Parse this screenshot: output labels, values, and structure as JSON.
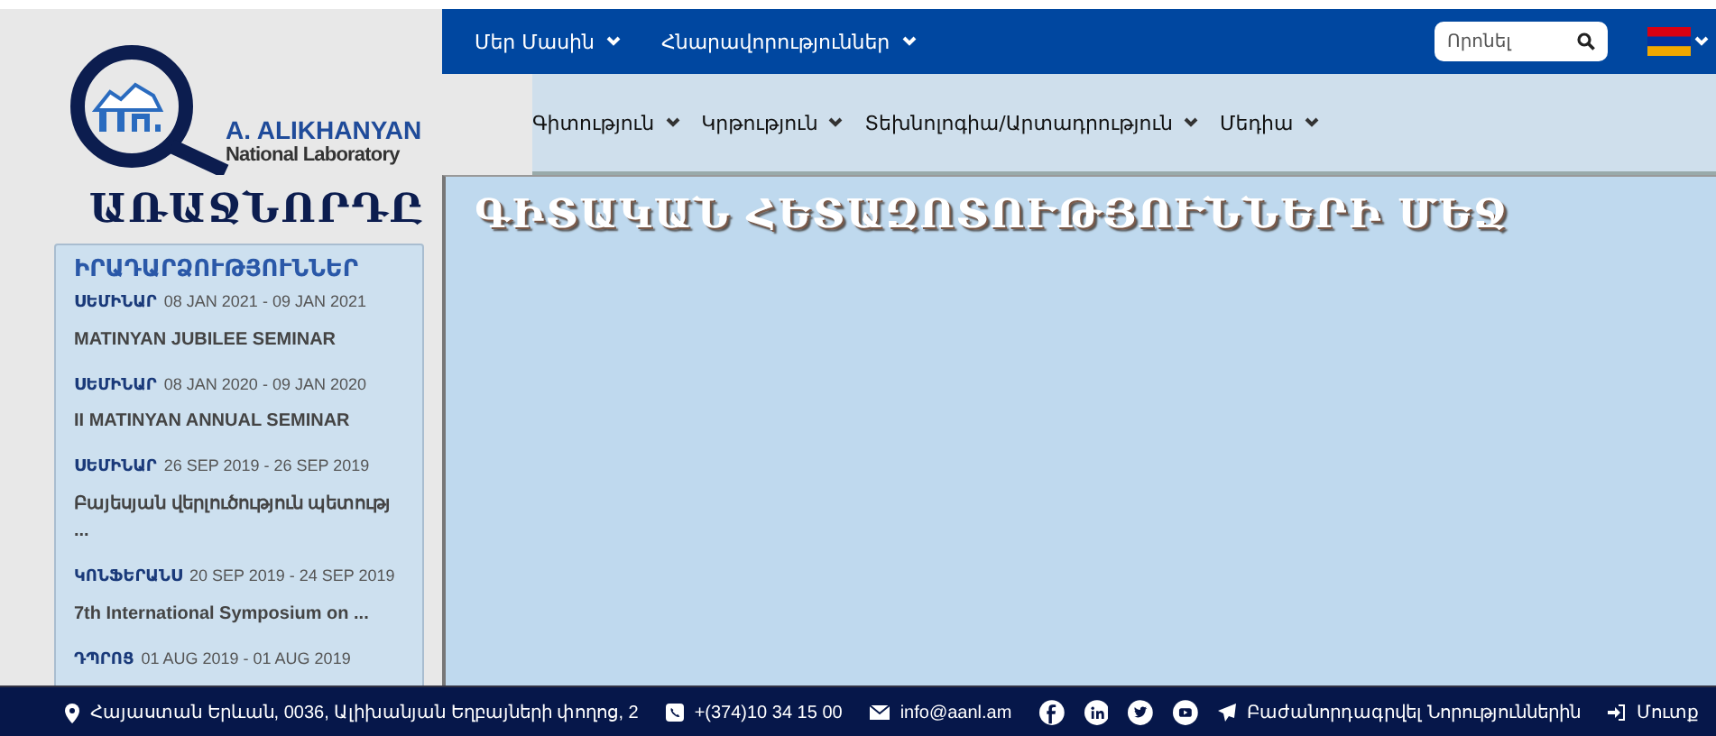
{
  "logo": {
    "line1": "A. ALIKHANYAN",
    "line2": "National Laboratory"
  },
  "top_menu": [
    {
      "label": "Մեր Մասին"
    },
    {
      "label": "Հնարավորություններ"
    }
  ],
  "search": {
    "placeholder": "Որոնել"
  },
  "main_menu": [
    {
      "label": "Գիտություն"
    },
    {
      "label": "Կրթություն"
    },
    {
      "label": "Տեխնոլոգիա/Արտադրություն"
    },
    {
      "label": "Մեդիա"
    }
  ],
  "sidebar": {
    "title": "ԱՌԱՋՆՈՐԴԸ",
    "panel_title": "ԻՐԱԴԱՐՁՈՒԹՅՈՒՆՆԵՐ",
    "events": [
      {
        "category": "ՍԵՄԻՆԱՐ",
        "dates": "08 JAN 2021 - 09 JAN 2021",
        "title": "MATINYAN JUBILEE SEMINAR"
      },
      {
        "category": "ՍԵՄԻՆԱՐ",
        "dates": "08 JAN 2020 - 09 JAN 2020",
        "title": "II MATINYAN ANNUAL SEMINAR"
      },
      {
        "category": "ՍԵՄԻՆԱՐ",
        "dates": "26 SEP 2019 - 26 SEP 2019",
        "title": "Բայեսյան վերլուծություն պետությ ..."
      },
      {
        "category": "ԿՈՆՖԵՐԱՆՍ",
        "dates": "20 SEP 2019 - 24 SEP 2019",
        "title": "7th International Symposium on  ..."
      },
      {
        "category": "ԴՊՐՈՑ",
        "dates": "01 AUG 2019 - 01 AUG 2019"
      }
    ]
  },
  "content": {
    "title": "ԳԻՏԱԿԱՆ ՀԵՏԱԶՈՏՈՒԹՅՈՒՆՆԵՐԻ ՄԵՋ"
  },
  "footer": {
    "address": "Հայաստան Երևան, 0036, Ալիխանյան Եղբայների փողոց, 2",
    "phone": "+(374)10 34 15 00",
    "email": "info@aanl.am",
    "socials": [
      {
        "kind": "facebook"
      },
      {
        "kind": "linkedin"
      },
      {
        "kind": "twitter"
      },
      {
        "kind": "youtube"
      }
    ],
    "subscribe": "Բաժանորդագրվել Նորություններին",
    "login": "Մուտք"
  }
}
